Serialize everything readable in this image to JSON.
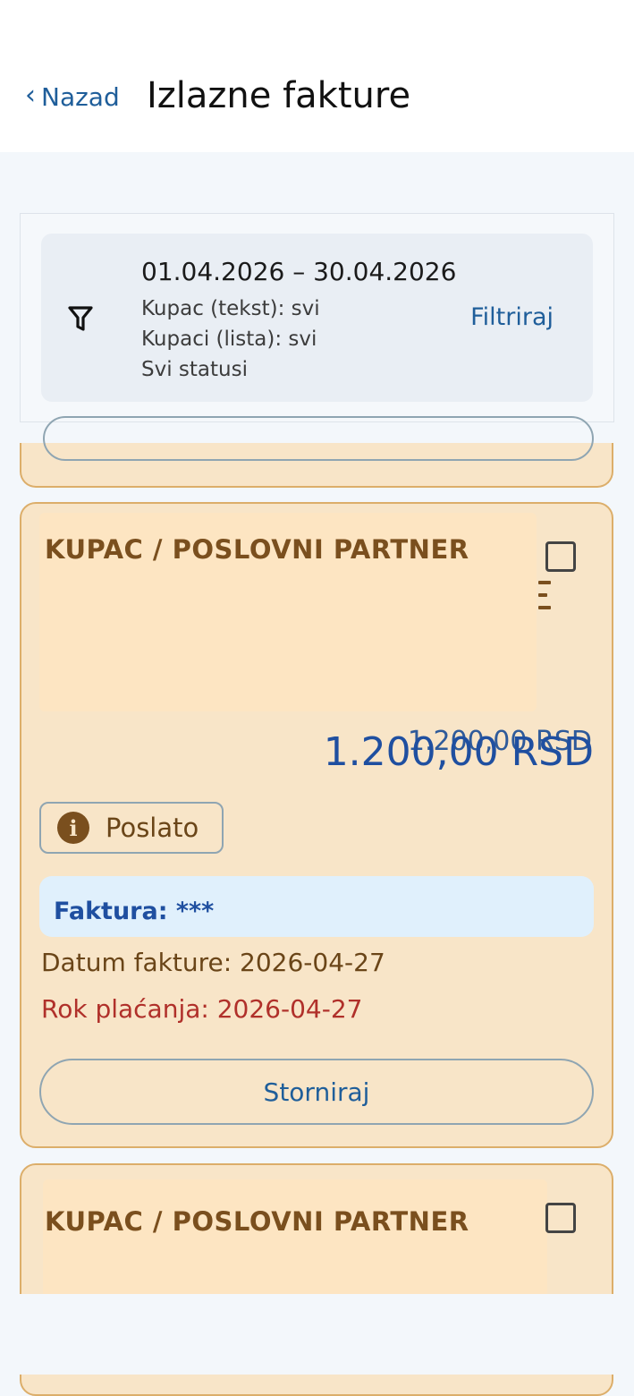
{
  "header": {
    "back_label": "Nazad",
    "title": "Izlazne fakture"
  },
  "filter": {
    "date_range": "01.04.2026 – 30.04.2026",
    "customer_text": "Kupac (tekst): svi",
    "customer_list": "Kupaci (lista): svi",
    "statuses": "Svi statusi",
    "button_label": "Filtriraj"
  },
  "invoice": {
    "customer_label": "KUPAC / POSLOVNI PARTNER",
    "amount": "1.200,00 RSD",
    "amount_ghost": "1.200,00 RSD",
    "status": "Poslato",
    "number_label": "Faktura: ***",
    "invoice_date": "Datum fakture: 2026-04-27",
    "due_date": "Rok plaćanja: 2026-04-27",
    "storno_label": "Storniraj"
  },
  "next_invoice": {
    "customer_label": "KUPAC / POSLOVNI PARTNER"
  },
  "icons": {
    "back": "chevron-left-icon",
    "filter": "filter-icon",
    "info": "info-icon",
    "more": "kebab-menu-icon"
  },
  "colors": {
    "card_bg": "#f8e5c8",
    "card_border": "#dcae6a",
    "accent_blue": "#1f5e9a",
    "due_red": "#b0302a"
  }
}
